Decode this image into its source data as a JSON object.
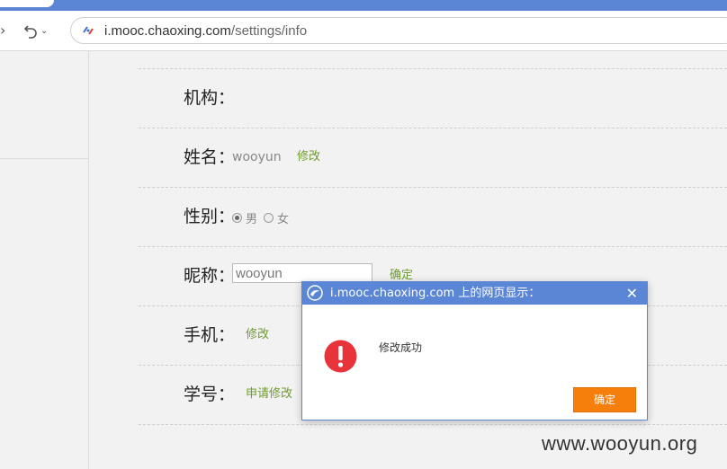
{
  "browser": {
    "address_host": "i.mooc.chaoxing.com",
    "address_path": "/settings/info"
  },
  "form": {
    "org_label": "机构：",
    "name_label": "姓名：",
    "name_value": "wooyun",
    "name_action": "修改",
    "gender_label": "性别：",
    "gender_options": [
      "男",
      "女"
    ],
    "gender_selected": "男",
    "nickname_label": "昵称：",
    "nickname_value": "wooyun",
    "nickname_action": "确定",
    "phone_label": "手机：",
    "phone_action": "修改",
    "student_id_label": "学号：",
    "student_id_action": "申请修改"
  },
  "dialog": {
    "title": "i.mooc.chaoxing.com 上的网页显示：",
    "close_symbol": "✕",
    "message": "修改成功",
    "ok_label": "确定",
    "ok_color": "#f57f0a"
  },
  "colors": {
    "accent": "#5b86d6",
    "link_green": "#6f9a2f",
    "alert_red": "#e8333a"
  },
  "watermark": "www.wooyun.org"
}
